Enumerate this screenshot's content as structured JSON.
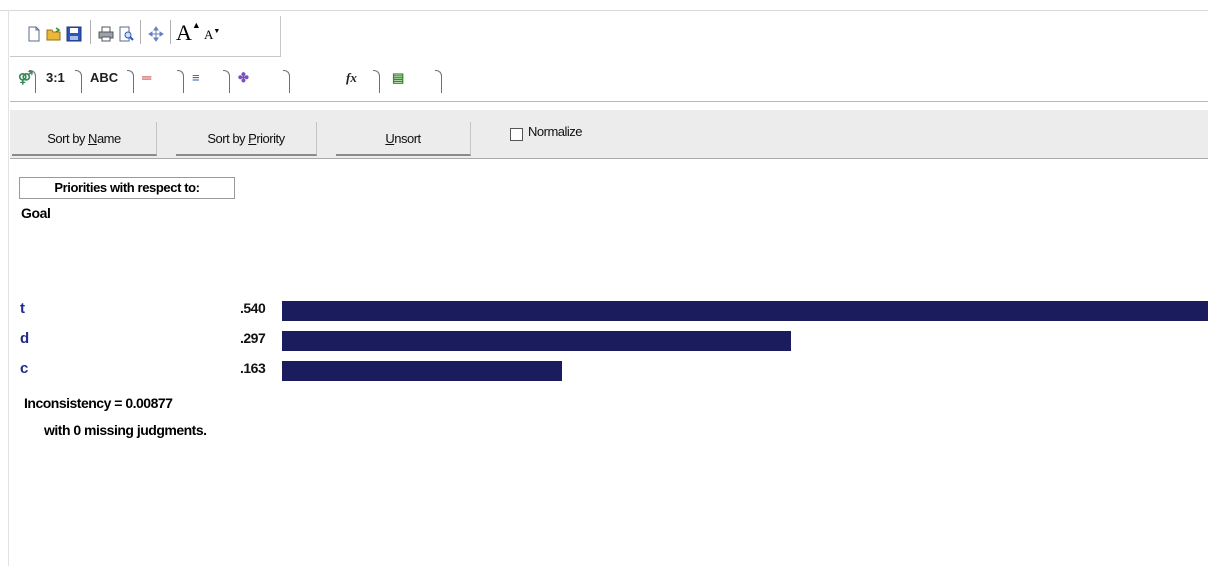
{
  "toolbar": {
    "icons": [
      "new-file-icon",
      "open-folder-icon",
      "save-icon",
      "print-icon",
      "print-preview-icon",
      "move-icon",
      "font-increase-icon",
      "font-decrease-icon"
    ],
    "font_increase_glyph": "A",
    "font_decrease_glyph": "A"
  },
  "tabs": [
    {
      "name": "tree-view-tab",
      "glyph": "⚤"
    },
    {
      "name": "pairwise-numeric-tab",
      "glyph": "3:1"
    },
    {
      "name": "verbal-tab",
      "glyph": "ABC"
    },
    {
      "name": "graphical-tab",
      "glyph": "═"
    },
    {
      "name": "priorities-tab",
      "glyph": "≡"
    },
    {
      "name": "sensitivity-tab",
      "glyph": "✤"
    },
    {
      "name": "formula-tab",
      "glyph": "fx"
    },
    {
      "name": "notes-tab",
      "glyph": "▤"
    }
  ],
  "sortbar": {
    "sort_name_pre": "Sort by ",
    "sort_name_ul": "N",
    "sort_name_post": "ame",
    "sort_priority_pre": "Sort by ",
    "sort_priority_ul": "P",
    "sort_priority_post": "riority",
    "unsort_ul": "U",
    "unsort_post": "nsort",
    "normalize": "Normalize",
    "normalize_checked": false
  },
  "content": {
    "priorities_header": "Priorities with respect to:",
    "goal": "Goal",
    "inconsistency": "Inconsistency = 0.00877",
    "missing": "with 0  missing judgments."
  },
  "chart_data": {
    "type": "bar",
    "orientation": "horizontal",
    "categories": [
      "t",
      "d",
      "c"
    ],
    "values": [
      0.54,
      0.297,
      0.163
    ],
    "value_labels": [
      ".540",
      ".297",
      ".163"
    ],
    "bar_color": "#1b1c5e",
    "label_color": "#1e2a8c"
  }
}
